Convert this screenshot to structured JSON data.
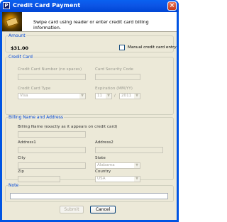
{
  "window": {
    "title": "Credit Card Payment",
    "close_label": "×",
    "icon_letter": "P"
  },
  "banner": {
    "text": "Swipe card using reader or enter credit card billing information."
  },
  "amount": {
    "legend": "Amount",
    "value": "$31.00",
    "manual_entry_label": "Manual credit card entry",
    "manual_entry_checked": false
  },
  "credit_card": {
    "legend": "Credit Card",
    "card_number_label": "Credit Card Number (no spaces)",
    "card_number_value": "",
    "security_code_label": "Card Security Code",
    "security_code_value": "",
    "card_type_label": "Credit Card Type",
    "card_type_value": "Visa",
    "expiration_label": "Expiration (MM/YY)",
    "exp_month_value": "11",
    "exp_separator": "/",
    "exp_year_value": "2011"
  },
  "billing": {
    "legend": "Billing Name and Address",
    "name_label": "Billing Name (exactly as it appears on credit card)",
    "name_value": "",
    "address1_label": "Address1",
    "address1_value": "",
    "address2_label": "Address2",
    "address2_value": "",
    "city_label": "City",
    "city_value": "",
    "state_label": "State",
    "state_value": "Alabama",
    "zip_label": "Zip",
    "zip_value": "",
    "country_label": "Country",
    "country_value": "USA"
  },
  "note": {
    "legend": "Note",
    "value": ""
  },
  "buttons": {
    "submit_label": "Submit",
    "cancel_label": "Cancel"
  },
  "colors": {
    "title_bar": "#0054e3",
    "group_label": "#0046d5",
    "window_face": "#ece9d8"
  }
}
